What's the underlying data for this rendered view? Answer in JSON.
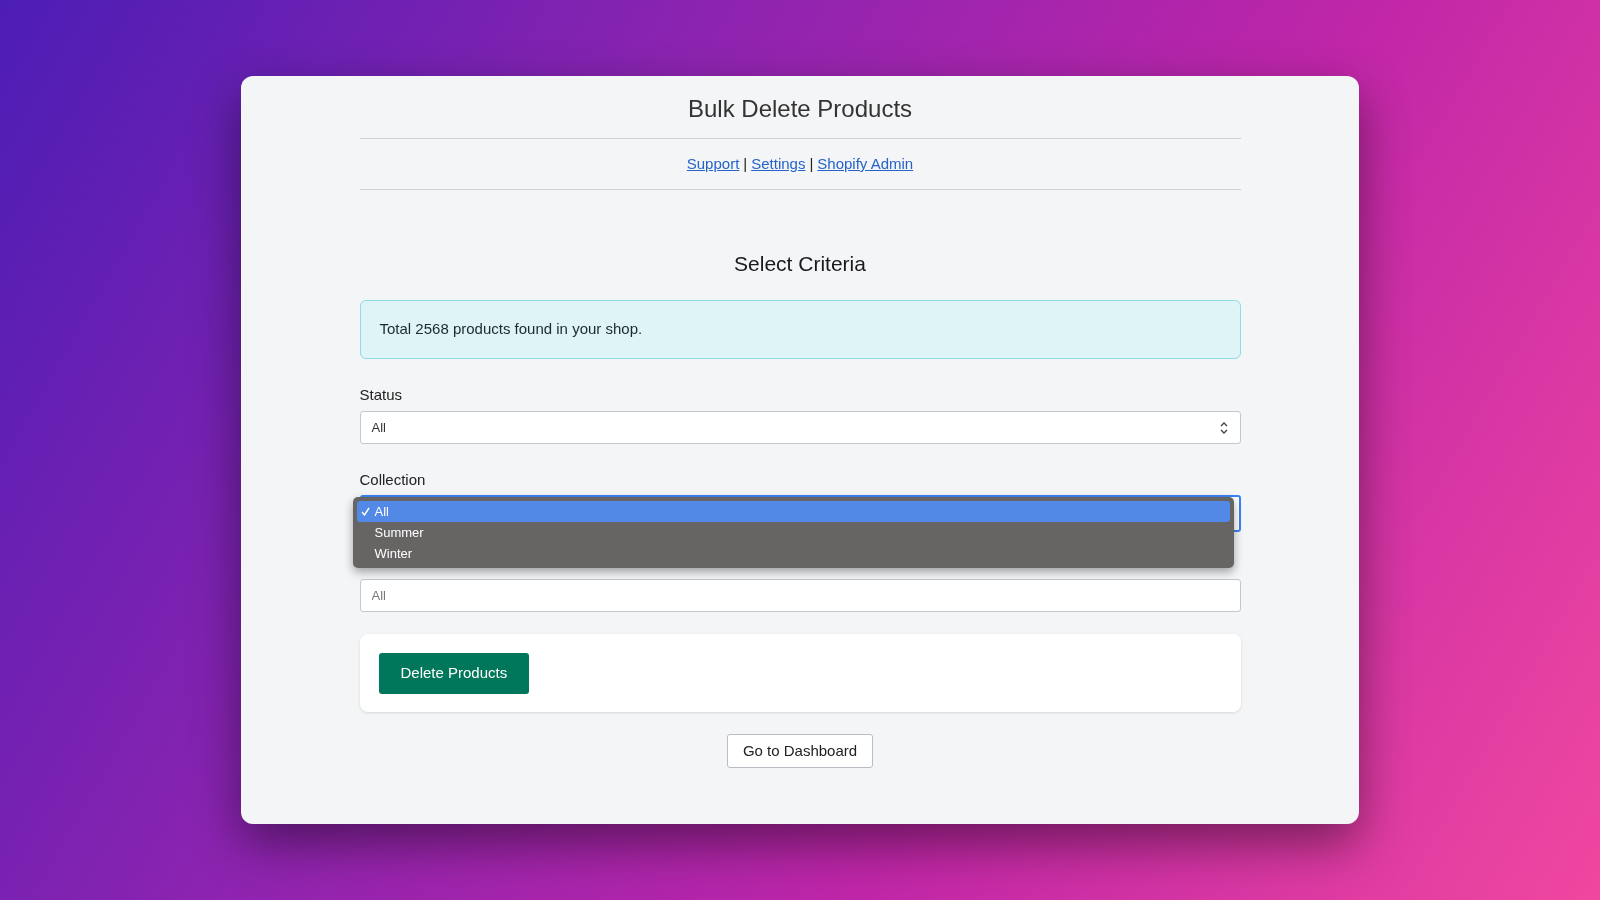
{
  "title": "Bulk Delete Products",
  "links": [
    {
      "label": "Support"
    },
    {
      "label": "Settings"
    },
    {
      "label": "Shopify Admin"
    }
  ],
  "link_separator": "|",
  "section_title": "Select Criteria",
  "alert": "Total 2568 products found in your shop.",
  "status": {
    "label": "Status",
    "value": "All"
  },
  "collection": {
    "label": "Collection",
    "focused": true,
    "options": [
      {
        "label": "All",
        "selected": true
      },
      {
        "label": "Summer",
        "selected": false
      },
      {
        "label": "Winter",
        "selected": false
      }
    ]
  },
  "filter_field": {
    "placeholder": "All"
  },
  "delete_button": "Delete Products",
  "dashboard_button": "Go to Dashboard"
}
